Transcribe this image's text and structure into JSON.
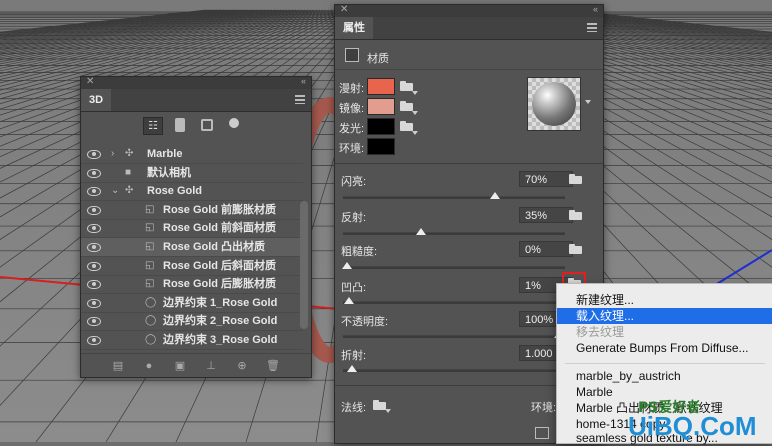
{
  "colors": {
    "accent": "#1f6ee8",
    "red_highlight": "#e02020",
    "ring": "#a6594e",
    "diffuse": "#e8644c",
    "specular": "#e39d8f",
    "watermark": "#1e8fd6"
  },
  "panel_3d": {
    "tab": "3D",
    "filter_icons": [
      "scene-filter-icon",
      "mesh-filter-icon",
      "material-filter-icon",
      "light-filter-icon"
    ],
    "rows": [
      {
        "label": "Marble",
        "icon": "mesh-icon"
      },
      {
        "label": "默认相机",
        "icon": "camera-icon"
      },
      {
        "label": "Rose Gold",
        "icon": "mesh-icon"
      },
      {
        "label": "Rose Gold 前膨胀材质",
        "icon": "material-icon"
      },
      {
        "label": "Rose Gold 前斜面材质",
        "icon": "material-icon"
      },
      {
        "label": "Rose Gold 凸出材质",
        "icon": "material-icon"
      },
      {
        "label": "Rose Gold 后斜面材质",
        "icon": "material-icon"
      },
      {
        "label": "Rose Gold 后膨胀材质",
        "icon": "material-icon"
      },
      {
        "label": "边界约束 1_Rose Gold",
        "icon": "constraint-icon"
      },
      {
        "label": "边界约束 2_Rose Gold",
        "icon": "constraint-icon"
      },
      {
        "label": "边界约束 3_Rose Gold",
        "icon": "constraint-icon"
      }
    ],
    "bottom_icons": [
      "scene-icon",
      "light-bulb-icon",
      "render-icon",
      "ground-icon",
      "constraint-add-icon",
      "trash-icon"
    ]
  },
  "panel_props": {
    "tab": "属性",
    "section": "材质",
    "diffuse_label": "漫射:",
    "specular_label": "镜像:",
    "illum_label": "发光:",
    "ambient_label": "环境:",
    "shine_label": "闪亮:",
    "shine_value": "70%",
    "shine_level": 0.7,
    "reflect_label": "反射:",
    "reflect_value": "35%",
    "reflect_level": 0.35,
    "rough_label": "粗糙度:",
    "rough_value": "0%",
    "rough_level": 0.0,
    "bump_label": "凹凸:",
    "bump_value": "1%",
    "bump_level": 0.01,
    "opacity_label": "不透明度:",
    "opacity_value": "100%",
    "opacity_level": 1.0,
    "refract_label": "折射:",
    "refract_value": "1.000",
    "normal_label": "法线:",
    "env_label": "环境:"
  },
  "context_menu": {
    "new_texture": "新建纹理...",
    "load_texture": "载入纹理...",
    "remove_texture": "移去纹理",
    "generate_bumps": "Generate Bumps From Diffuse...",
    "recent_1": "marble_by_austrich",
    "recent_2": "Marble",
    "recent_3": "Marble 凸出材质 - 默认纹理",
    "recent_4": "home-1314 copy",
    "recent_5": "seamless gold texture by..."
  },
  "watermark": "UiBQ.CoM",
  "watermark_sub": "PS爱好者"
}
